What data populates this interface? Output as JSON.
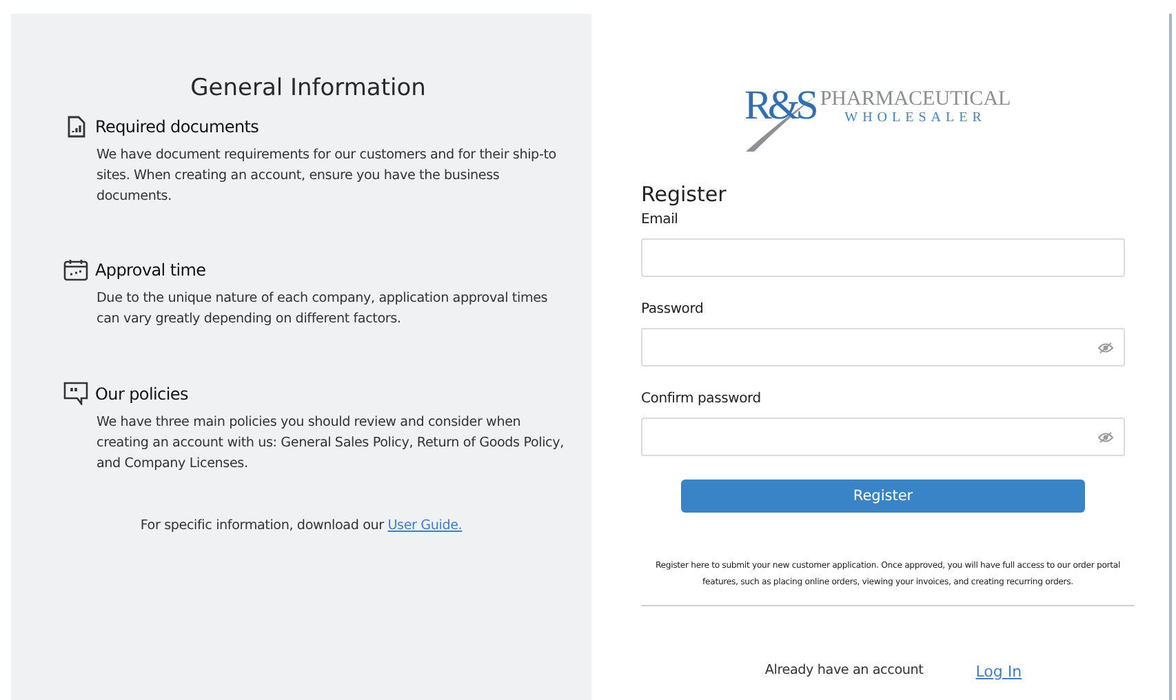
{
  "info": {
    "title": "General Information",
    "sections": [
      {
        "kind": "document",
        "heading": "Required documents",
        "body": "We have document requirements for our customers and for their ship-to sites. When creating an account, ensure you have the business documents."
      },
      {
        "kind": "calendar",
        "heading": "Approval time",
        "body": "Due to the unique nature of each company, application approval times can vary greatly depending on different factors."
      },
      {
        "kind": "quote",
        "heading": "Our policies",
        "body": "We have three main policies you should review and consider when creating an account with us: General Sales Policy, Return of Goods Policy, and Company Licenses."
      }
    ],
    "footer": {
      "text": "For specific information, download our",
      "link": "User Guide."
    }
  },
  "logo": {
    "mark": "R&S",
    "name": "PHARMACEUTICAL",
    "tagline": "WHOLESALER"
  },
  "form": {
    "title": "Register",
    "fields": [
      {
        "label": "Email",
        "kind": "text"
      },
      {
        "label": "Password",
        "kind": "password"
      },
      {
        "label": "Confirm password",
        "kind": "password"
      }
    ],
    "button": "Register",
    "note": "Register here to submit your new customer application. Once approved, you will have full access to our order portal features, such as placing online orders, viewing your invoices, and creating recurring orders.",
    "login": {
      "text": "Already have an account",
      "link": "Log In"
    }
  }
}
